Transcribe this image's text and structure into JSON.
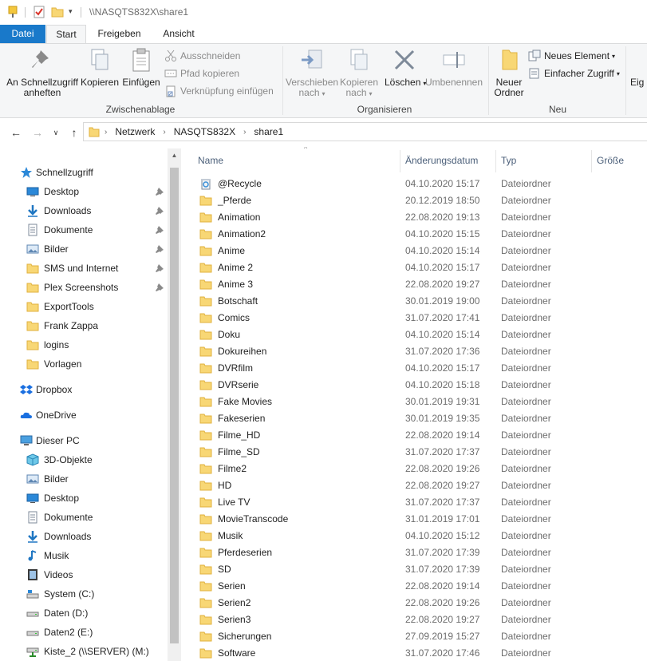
{
  "window": {
    "title": "\\\\NASQTS832X\\share1"
  },
  "ribbon_tabs": [
    {
      "label": "Datei"
    },
    {
      "label": "Start"
    },
    {
      "label": "Freigeben"
    },
    {
      "label": "Ansicht"
    }
  ],
  "ribbon": {
    "clipboard": {
      "pin_label_1": "An Schnellzugriff",
      "pin_label_2": "anheften",
      "copy_label": "Kopieren",
      "paste_label": "Einfügen",
      "cut_label": "Ausschneiden",
      "copy_path_label": "Pfad kopieren",
      "paste_shortcut_label": "Verknüpfung einfügen",
      "group_label": "Zwischenablage"
    },
    "organize": {
      "move_label_1": "Verschieben",
      "move_label_2": "nach",
      "copy_to_label_1": "Kopieren",
      "copy_to_label_2": "nach",
      "delete_label": "Löschen",
      "rename_label": "Umbenennen",
      "group_label": "Organisieren"
    },
    "new": {
      "new_folder_label_1": "Neuer",
      "new_folder_label_2": "Ordner",
      "new_item_label": "Neues Element",
      "easy_access_label": "Einfacher Zugriff",
      "group_label": "Neu"
    },
    "overflow_label": "Eig"
  },
  "address": {
    "crumbs": [
      "Netzwerk",
      "NASQTS832X",
      "share1"
    ]
  },
  "nav_pane": {
    "quick_access": "Schnellzugriff",
    "quick_items": [
      {
        "label": "Desktop",
        "icon": "desktop-icon",
        "pinned": true
      },
      {
        "label": "Downloads",
        "icon": "downloads-icon",
        "pinned": true
      },
      {
        "label": "Dokumente",
        "icon": "documents-icon",
        "pinned": true
      },
      {
        "label": "Bilder",
        "icon": "pictures-icon",
        "pinned": true
      },
      {
        "label": "SMS und Internet",
        "icon": "folder-icon",
        "pinned": true
      },
      {
        "label": "Plex Screenshots",
        "icon": "folder-icon",
        "pinned": true
      },
      {
        "label": "ExportTools",
        "icon": "folder-icon",
        "pinned": false
      },
      {
        "label": "Frank Zappa",
        "icon": "folder-icon",
        "pinned": false
      },
      {
        "label": "logins",
        "icon": "folder-icon",
        "pinned": false
      },
      {
        "label": "Vorlagen",
        "icon": "folder-icon",
        "pinned": false
      }
    ],
    "dropbox": "Dropbox",
    "onedrive": "OneDrive",
    "this_pc": "Dieser PC",
    "pc_items": [
      {
        "label": "3D-Objekte",
        "icon": "3d-objects-icon"
      },
      {
        "label": "Bilder",
        "icon": "pictures-icon"
      },
      {
        "label": "Desktop",
        "icon": "desktop-icon"
      },
      {
        "label": "Dokumente",
        "icon": "documents-icon"
      },
      {
        "label": "Downloads",
        "icon": "downloads-icon"
      },
      {
        "label": "Musik",
        "icon": "music-icon"
      },
      {
        "label": "Videos",
        "icon": "videos-icon"
      },
      {
        "label": "System (C:)",
        "icon": "system-drive-icon"
      },
      {
        "label": "Daten (D:)",
        "icon": "drive-icon"
      },
      {
        "label": "Daten2 (E:)",
        "icon": "drive-icon"
      },
      {
        "label": "Kiste_2 (\\\\SERVER) (M:)",
        "icon": "network-drive-icon"
      }
    ]
  },
  "columns": {
    "name": "Name",
    "date": "Änderungsdatum",
    "type": "Typ",
    "size": "Größe"
  },
  "files": [
    {
      "name": "@Recycle",
      "date": "04.10.2020 15:17",
      "type": "Dateiordner",
      "icon": "recycle-icon"
    },
    {
      "name": "_Pferde",
      "date": "20.12.2019 18:50",
      "type": "Dateiordner",
      "icon": "folder-icon"
    },
    {
      "name": "Animation",
      "date": "22.08.2020 19:13",
      "type": "Dateiordner",
      "icon": "folder-icon"
    },
    {
      "name": "Animation2",
      "date": "04.10.2020 15:15",
      "type": "Dateiordner",
      "icon": "folder-icon"
    },
    {
      "name": "Anime",
      "date": "04.10.2020 15:14",
      "type": "Dateiordner",
      "icon": "folder-icon"
    },
    {
      "name": "Anime 2",
      "date": "04.10.2020 15:17",
      "type": "Dateiordner",
      "icon": "folder-icon"
    },
    {
      "name": "Anime 3",
      "date": "22.08.2020 19:27",
      "type": "Dateiordner",
      "icon": "folder-icon"
    },
    {
      "name": "Botschaft",
      "date": "30.01.2019 19:00",
      "type": "Dateiordner",
      "icon": "folder-icon"
    },
    {
      "name": "Comics",
      "date": "31.07.2020 17:41",
      "type": "Dateiordner",
      "icon": "folder-icon"
    },
    {
      "name": "Doku",
      "date": "04.10.2020 15:14",
      "type": "Dateiordner",
      "icon": "folder-icon"
    },
    {
      "name": "Dokureihen",
      "date": "31.07.2020 17:36",
      "type": "Dateiordner",
      "icon": "folder-icon"
    },
    {
      "name": "DVRfilm",
      "date": "04.10.2020 15:17",
      "type": "Dateiordner",
      "icon": "folder-icon"
    },
    {
      "name": "DVRserie",
      "date": "04.10.2020 15:18",
      "type": "Dateiordner",
      "icon": "folder-icon"
    },
    {
      "name": "Fake Movies",
      "date": "30.01.2019 19:31",
      "type": "Dateiordner",
      "icon": "folder-icon"
    },
    {
      "name": "Fakeserien",
      "date": "30.01.2019 19:35",
      "type": "Dateiordner",
      "icon": "folder-icon"
    },
    {
      "name": "Filme_HD",
      "date": "22.08.2020 19:14",
      "type": "Dateiordner",
      "icon": "folder-icon"
    },
    {
      "name": "Filme_SD",
      "date": "31.07.2020 17:37",
      "type": "Dateiordner",
      "icon": "folder-icon"
    },
    {
      "name": "Filme2",
      "date": "22.08.2020 19:26",
      "type": "Dateiordner",
      "icon": "folder-icon"
    },
    {
      "name": "HD",
      "date": "22.08.2020 19:27",
      "type": "Dateiordner",
      "icon": "folder-icon"
    },
    {
      "name": "Live TV",
      "date": "31.07.2020 17:37",
      "type": "Dateiordner",
      "icon": "folder-icon"
    },
    {
      "name": "MovieTranscode",
      "date": "31.01.2019 17:01",
      "type": "Dateiordner",
      "icon": "folder-icon"
    },
    {
      "name": "Musik",
      "date": "04.10.2020 15:12",
      "type": "Dateiordner",
      "icon": "folder-icon"
    },
    {
      "name": "Pferdeserien",
      "date": "31.07.2020 17:39",
      "type": "Dateiordner",
      "icon": "folder-icon"
    },
    {
      "name": "SD",
      "date": "31.07.2020 17:39",
      "type": "Dateiordner",
      "icon": "folder-icon"
    },
    {
      "name": "Serien",
      "date": "22.08.2020 19:14",
      "type": "Dateiordner",
      "icon": "folder-icon"
    },
    {
      "name": "Serien2",
      "date": "22.08.2020 19:26",
      "type": "Dateiordner",
      "icon": "folder-icon"
    },
    {
      "name": "Serien3",
      "date": "22.08.2020 19:27",
      "type": "Dateiordner",
      "icon": "folder-icon"
    },
    {
      "name": "Sicherungen",
      "date": "27.09.2019 15:27",
      "type": "Dateiordner",
      "icon": "folder-icon"
    },
    {
      "name": "Software",
      "date": "31.07.2020 17:46",
      "type": "Dateiordner",
      "icon": "folder-icon"
    }
  ],
  "colors": {
    "accent": "#1979ca",
    "folder": "#f8d775",
    "folder_dark": "#e0b23e",
    "ribbon_bg": "#f5f6f7"
  }
}
